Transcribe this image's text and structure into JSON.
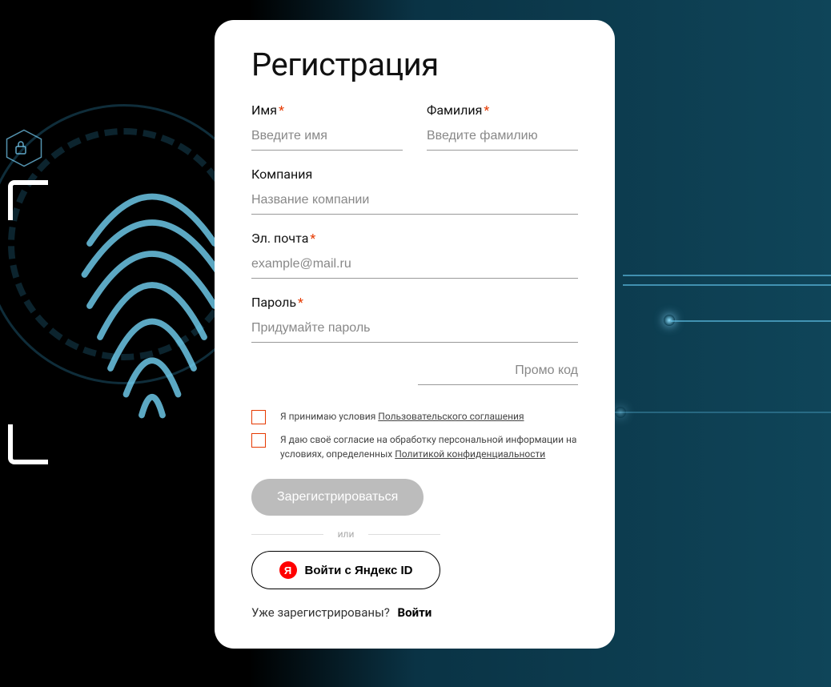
{
  "title": "Регистрация",
  "fields": {
    "first_name": {
      "label": "Имя",
      "placeholder": "Введите имя",
      "required": true
    },
    "last_name": {
      "label": "Фамилия",
      "placeholder": "Введите фамилию",
      "required": true
    },
    "company": {
      "label": "Компания",
      "placeholder": "Название компании",
      "required": false
    },
    "email": {
      "label": "Эл. почта",
      "placeholder": "example@mail.ru",
      "required": true
    },
    "password": {
      "label": "Пароль",
      "placeholder": "Придумайте пароль",
      "required": true
    },
    "promo": {
      "placeholder": "Промо код"
    }
  },
  "consents": {
    "terms": {
      "prefix": "Я принимаю условия ",
      "link": "Пользовательского соглашения"
    },
    "privacy": {
      "prefix": "Я даю своё согласие на обработку персональной информации на условиях, определенных ",
      "link": "Политикой конфиденциальности"
    }
  },
  "buttons": {
    "register": "Зарегистрироваться",
    "divider": "или",
    "yandex": "Войти с Яндекс ID",
    "yandex_icon_text": "Я"
  },
  "login_prompt": {
    "text": "Уже зарегистрированы?",
    "link": "Войти"
  },
  "colors": {
    "accent_error": "#e63900",
    "card_bg": "#ffffff",
    "yandex_red": "#ff0000"
  }
}
